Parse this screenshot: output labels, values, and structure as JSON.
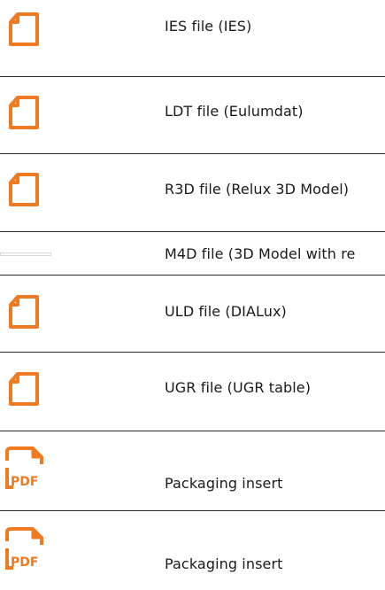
{
  "accent_color": "#ee7a22",
  "rows": [
    {
      "label": "IES file (IES)",
      "icon": "file-icon"
    },
    {
      "label": "LDT file (Eulumdat)",
      "icon": "file-icon"
    },
    {
      "label": "R3D file (Relux 3D Model)",
      "icon": "file-icon"
    },
    {
      "label": "M4D file (3D Model with re",
      "icon": "image-placeholder"
    },
    {
      "label": "ULD file (DIALux)",
      "icon": "file-icon"
    },
    {
      "label": "UGR file (UGR table)",
      "icon": "file-icon"
    },
    {
      "label": "Packaging insert",
      "icon": "pdf-file-icon",
      "icon_text": "PDF"
    },
    {
      "label": "Packaging insert",
      "icon": "pdf-file-icon",
      "icon_text": "PDF"
    }
  ]
}
